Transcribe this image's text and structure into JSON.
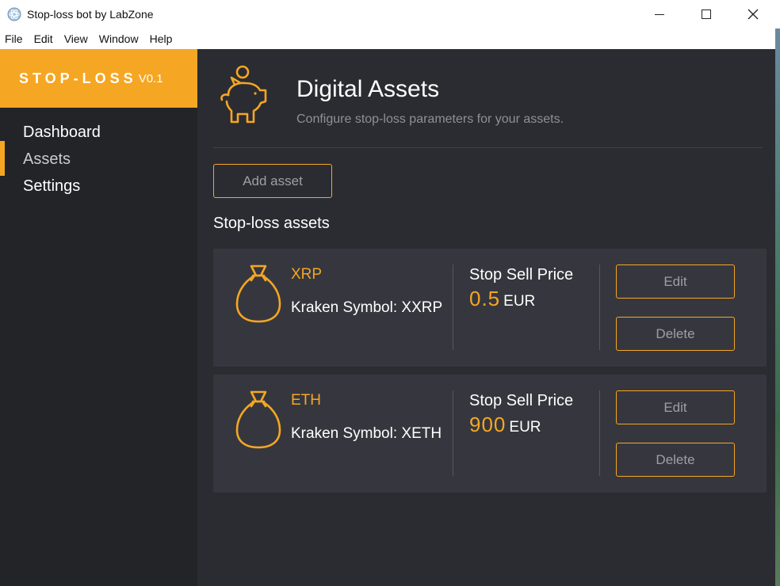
{
  "window": {
    "title": "Stop-loss bot by LabZone"
  },
  "menu": [
    "File",
    "Edit",
    "View",
    "Window",
    "Help"
  ],
  "brand": {
    "logo": "STOP-LOSS",
    "version": "V0.1",
    "accent_color": "#f5a623"
  },
  "sidebar": {
    "items": [
      {
        "label": "Dashboard",
        "active": false
      },
      {
        "label": "Assets",
        "active": true
      },
      {
        "label": "Settings",
        "active": false
      }
    ]
  },
  "page": {
    "title": "Digital Assets",
    "subtitle": "Configure stop-loss parameters for your assets.",
    "icon": "piggy-bank-icon"
  },
  "add_asset_label": "Add asset",
  "section_title": "Stop-loss assets",
  "assets": [
    {
      "name": "XRP",
      "symbol_text": "Kraken Symbol: XXRP",
      "price_label": "Stop Sell Price",
      "price_value": "0.5",
      "currency": "EUR",
      "edit_label": "Edit",
      "delete_label": "Delete",
      "icon": "money-bag-icon"
    },
    {
      "name": "ETH",
      "symbol_text": "Kraken Symbol: XETH",
      "price_label": "Stop Sell Price",
      "price_value": "900",
      "currency": "EUR",
      "edit_label": "Edit",
      "delete_label": "Delete",
      "icon": "money-bag-icon"
    }
  ]
}
